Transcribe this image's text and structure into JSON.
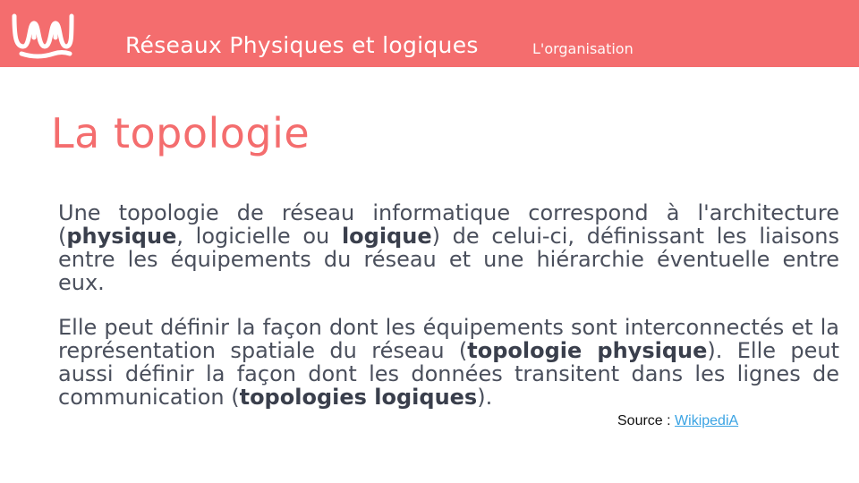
{
  "header": {
    "title": "Réseaux Physiques et logiques",
    "subtitle": "L'organisation",
    "logo_icon": "wave-logo-icon",
    "bg_color": "#f46d6e"
  },
  "slide": {
    "title": "La topologie",
    "p1": {
      "t1": "Une topologie de réseau informatique correspond à l'architecture (",
      "b1": "physique",
      "t2": ", logicielle ou ",
      "b2": "logique",
      "t3": ") de celui-ci, définissant les liaisons entre les équipements du réseau et une hiérarchie éventuelle entre eux."
    },
    "p2": {
      "t1": "Elle peut définir la façon dont les équipements sont interconnectés et la représentation spatiale du réseau (",
      "b1": "topologie physique",
      "t2": "). Elle peut aussi définir la façon dont les données transitent dans les lignes de communication (",
      "b2": "topologies logiques",
      "t3": ")."
    },
    "source": {
      "label": "Source : ",
      "link_text": "WikipediA"
    }
  }
}
